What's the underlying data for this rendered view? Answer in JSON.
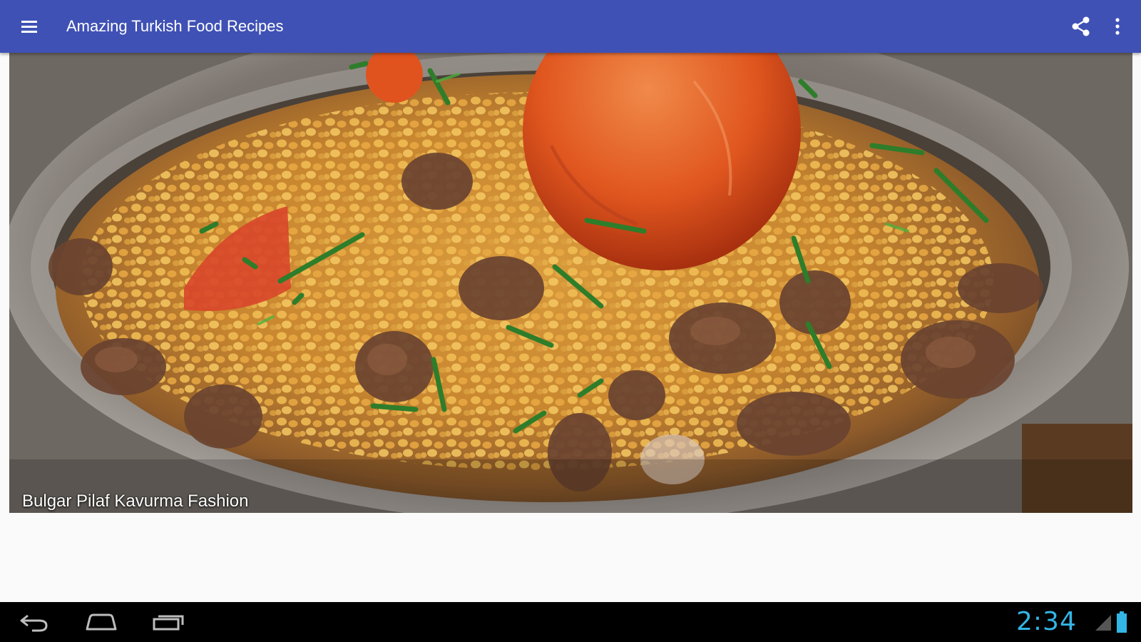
{
  "app_bar": {
    "title": "Amazing Turkish Food Recipes",
    "menu_icon": "hamburger-menu-icon",
    "share_icon": "share-icon",
    "overflow_icon": "more-vert-icon",
    "background_color": "#3f51b5",
    "text_color": "#ffffff"
  },
  "recipe": {
    "name": "Bulgar Pilaf Kavurma Fashion",
    "image": "bulgur-pilaf-photo"
  },
  "system_bar": {
    "back_icon": "back-icon",
    "home_icon": "home-icon",
    "recents_icon": "recent-apps-icon",
    "time": "2:34",
    "signal_icon": "signal-icon",
    "battery_icon": "battery-icon",
    "accent_color": "#33b5e5"
  }
}
